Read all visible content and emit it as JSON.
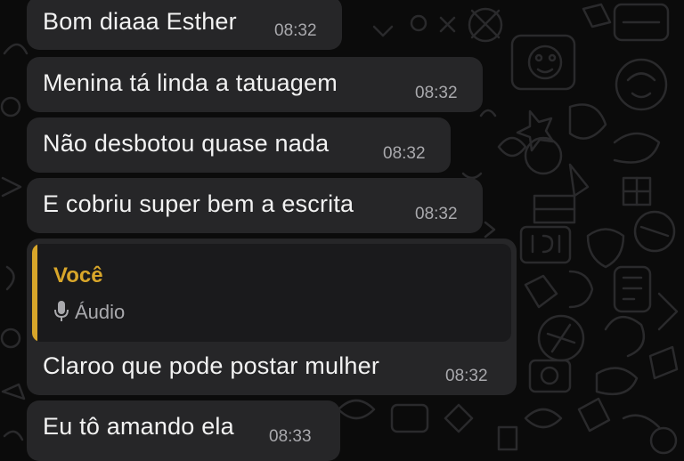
{
  "chat": {
    "messages": [
      {
        "text": "Bom diaaa Esther",
        "time": "08:32"
      },
      {
        "text": "Menina tá linda a tatuagem",
        "time": "08:32"
      },
      {
        "text": "Não desbotou quase nada",
        "time": "08:32"
      },
      {
        "text": "E cobriu super bem a escrita",
        "time": "08:32"
      },
      {
        "quote": {
          "author": "Você",
          "type": "Áudio",
          "icon": "microphone-icon"
        },
        "text": "Claroo que pode postar mulher",
        "time": "08:32"
      },
      {
        "text": "Eu tô amando ela",
        "time": "08:33"
      }
    ]
  },
  "colors": {
    "background": "#0b0b0b",
    "bubble": "#262628",
    "quote_background": "#1a1a1c",
    "accent": "#d8a62a",
    "text": "#f2f2f2",
    "timestamp": "#a9a9ad"
  }
}
